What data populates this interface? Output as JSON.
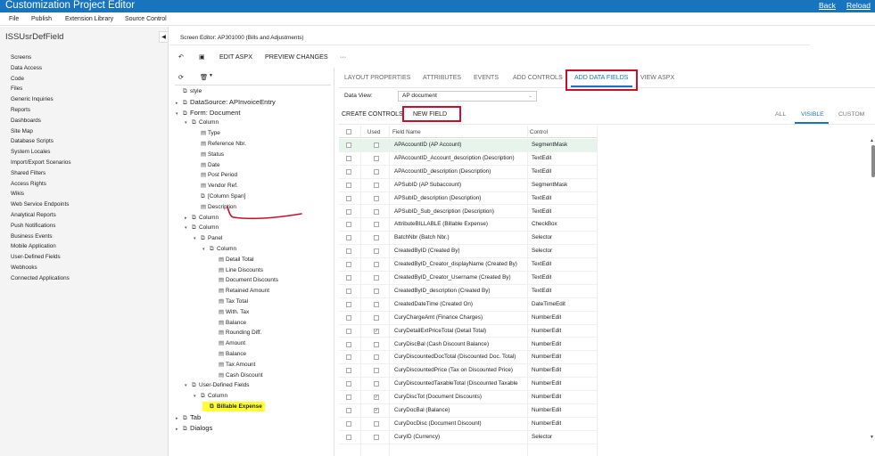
{
  "app": {
    "title": "Customization Project Editor",
    "back": "Back",
    "reload": "Reload"
  },
  "menu": [
    "File",
    "Publish",
    "Extension Library",
    "Source Control"
  ],
  "project": {
    "name": "ISSUsrDefField"
  },
  "left_nav": [
    "Screens",
    "Data Access",
    "Code",
    "Files",
    "Generic Inquiries",
    "Reports",
    "Dashboards",
    "Site Map",
    "Database Scripts",
    "System Locales",
    "Import/Export Scenarios",
    "Shared Filters",
    "Access Rights",
    "Wikis",
    "Web Service Endpoints",
    "Analytical Reports",
    "Push Notifications",
    "Business Events",
    "Mobile Application",
    "User-Defined Fields",
    "Webhooks",
    "Connected Applications"
  ],
  "screen_editor": {
    "label": "Screen Editor: AP301000 (Bills and Adjustments)"
  },
  "toolbar": {
    "edit_aspx": "EDIT ASPX",
    "preview_changes": "PREVIEW CHANGES",
    "more": "···"
  },
  "tree": [
    {
      "label": "style",
      "level": 0,
      "chev": "",
      "big": false,
      "icon": "form"
    },
    {
      "label": "DataSource: APInvoiceEntry",
      "level": 0,
      "chev": "right",
      "big": true,
      "icon": "form"
    },
    {
      "label": "Form: Document",
      "level": 0,
      "chev": "down",
      "big": true,
      "icon": "form"
    },
    {
      "label": "Column",
      "level": 1,
      "chev": "down",
      "big": false,
      "icon": "form"
    },
    {
      "label": "Type",
      "level": 2,
      "chev": "",
      "big": false,
      "icon": "field"
    },
    {
      "label": "Reference Nbr.",
      "level": 2,
      "chev": "",
      "big": false,
      "icon": "field"
    },
    {
      "label": "Status",
      "level": 2,
      "chev": "",
      "big": false,
      "icon": "field"
    },
    {
      "label": "Date",
      "level": 2,
      "chev": "",
      "big": false,
      "icon": "field"
    },
    {
      "label": "Post Period",
      "level": 2,
      "chev": "",
      "big": false,
      "icon": "field"
    },
    {
      "label": "Vendor Ref.",
      "level": 2,
      "chev": "",
      "big": false,
      "icon": "field"
    },
    {
      "label": "[Column Span]",
      "level": 2,
      "chev": "",
      "big": false,
      "icon": "form"
    },
    {
      "label": "Description",
      "level": 2,
      "chev": "",
      "big": false,
      "icon": "field"
    },
    {
      "label": "Column",
      "level": 1,
      "chev": "right",
      "big": false,
      "icon": "form"
    },
    {
      "label": "Column",
      "level": 1,
      "chev": "down",
      "big": false,
      "icon": "form"
    },
    {
      "label": "Panel",
      "level": 2,
      "chev": "down",
      "big": false,
      "icon": "form"
    },
    {
      "label": "Column",
      "level": 3,
      "chev": "down",
      "big": false,
      "icon": "form"
    },
    {
      "label": "Detail Total",
      "level": 4,
      "chev": "",
      "big": false,
      "icon": "field"
    },
    {
      "label": "Line Discounts",
      "level": 4,
      "chev": "",
      "big": false,
      "icon": "field"
    },
    {
      "label": "Document Discounts",
      "level": 4,
      "chev": "",
      "big": false,
      "icon": "field"
    },
    {
      "label": "Retained Amount",
      "level": 4,
      "chev": "",
      "big": false,
      "icon": "field"
    },
    {
      "label": "Tax Total",
      "level": 4,
      "chev": "",
      "big": false,
      "icon": "field"
    },
    {
      "label": "With. Tax",
      "level": 4,
      "chev": "",
      "big": false,
      "icon": "field"
    },
    {
      "label": "Balance",
      "level": 4,
      "chev": "",
      "big": false,
      "icon": "field"
    },
    {
      "label": "Rounding Diff.",
      "level": 4,
      "chev": "",
      "big": false,
      "icon": "field"
    },
    {
      "label": "Amount",
      "level": 4,
      "chev": "",
      "big": false,
      "icon": "field"
    },
    {
      "label": "Balance",
      "level": 4,
      "chev": "",
      "big": false,
      "icon": "field"
    },
    {
      "label": "Tax Amount",
      "level": 4,
      "chev": "",
      "big": false,
      "icon": "field"
    },
    {
      "label": "Cash Discount",
      "level": 4,
      "chev": "",
      "big": false,
      "icon": "field"
    },
    {
      "label": "User-Defined Fields",
      "level": 1,
      "chev": "down",
      "big": false,
      "icon": "form"
    },
    {
      "label": "Column",
      "level": 2,
      "chev": "down",
      "big": false,
      "icon": "form"
    },
    {
      "label": "Billable Expense",
      "level": 3,
      "chev": "",
      "big": false,
      "icon": "form",
      "highlight": true
    },
    {
      "label": "Tab",
      "level": 0,
      "chev": "right",
      "big": true,
      "icon": "form"
    },
    {
      "label": "Dialogs",
      "level": 0,
      "chev": "right",
      "big": true,
      "icon": "form"
    }
  ],
  "tabs": [
    "LAYOUT PROPERTIES",
    "ATTRIBUTES",
    "EVENTS",
    "ADD CONTROLS",
    "ADD DATA FIELDS",
    "VIEW ASPX"
  ],
  "active_tab": "ADD DATA FIELDS",
  "data_view": {
    "label": "Data View:",
    "value": "AP document"
  },
  "controls": {
    "create": "CREATE CONTROLS",
    "new_field": "NEW FIELD"
  },
  "filters": {
    "all": "ALL",
    "visible": "VISIBLE",
    "custom": "CUSTOM"
  },
  "grid": {
    "headers": {
      "used": "Used",
      "field_name": "Field Name",
      "control": "Control"
    },
    "rows": [
      {
        "field": "APAccountID (AP Account)",
        "control": "SegmentMask",
        "used": false,
        "selected": true
      },
      {
        "field": "APAccountID_Account_description (Description)",
        "control": "TextEdit",
        "used": false
      },
      {
        "field": "APAccountID_description (Description)",
        "control": "TextEdit",
        "used": false
      },
      {
        "field": "APSubID (AP Subaccount)",
        "control": "SegmentMask",
        "used": false
      },
      {
        "field": "APSubID_description (Description)",
        "control": "TextEdit",
        "used": false
      },
      {
        "field": "APSubID_Sub_description (Description)",
        "control": "TextEdit",
        "used": false
      },
      {
        "field": "AttributeBILLABLE (Billable Expense)",
        "control": "CheckBox",
        "used": false
      },
      {
        "field": "BatchNbr (Batch Nbr.)",
        "control": "Selector",
        "used": false
      },
      {
        "field": "CreatedByID (Created By)",
        "control": "Selector",
        "used": false
      },
      {
        "field": "CreatedByID_Creator_displayName (Created By)",
        "control": "TextEdit",
        "used": false
      },
      {
        "field": "CreatedByID_Creator_Username (Created By)",
        "control": "TextEdit",
        "used": false
      },
      {
        "field": "CreatedByID_description (Created By)",
        "control": "TextEdit",
        "used": false
      },
      {
        "field": "CreatedDateTime (Created On)",
        "control": "DateTimeEdit",
        "used": false
      },
      {
        "field": "CuryChargeAmt (Finance Charges)",
        "control": "NumberEdit",
        "used": false
      },
      {
        "field": "CuryDetailExtPriceTotal (Detail Total)",
        "control": "NumberEdit",
        "used": true
      },
      {
        "field": "CuryDiscBal (Cash Discount Balance)",
        "control": "NumberEdit",
        "used": false
      },
      {
        "field": "CuryDiscountedDocTotal (Discounted Doc. Total)",
        "control": "NumberEdit",
        "used": false
      },
      {
        "field": "CuryDiscountedPrice (Tax on Discounted Price)",
        "control": "NumberEdit",
        "used": false
      },
      {
        "field": "CuryDiscountedTaxableTotal (Discounted Taxable",
        "control": "NumberEdit",
        "used": false
      },
      {
        "field": "CuryDiscTot (Document Discounts)",
        "control": "NumberEdit",
        "used": true
      },
      {
        "field": "CuryDocBal (Balance)",
        "control": "NumberEdit",
        "used": true
      },
      {
        "field": "CuryDocDisc (Document Discount)",
        "control": "NumberEdit",
        "used": false
      },
      {
        "field": "CuryID (Currency)",
        "control": "Selector",
        "used": false
      }
    ]
  },
  "colors": {
    "brand": "#1774bd",
    "annotation_red": "#c8102e",
    "highlight": "#ffff33"
  }
}
